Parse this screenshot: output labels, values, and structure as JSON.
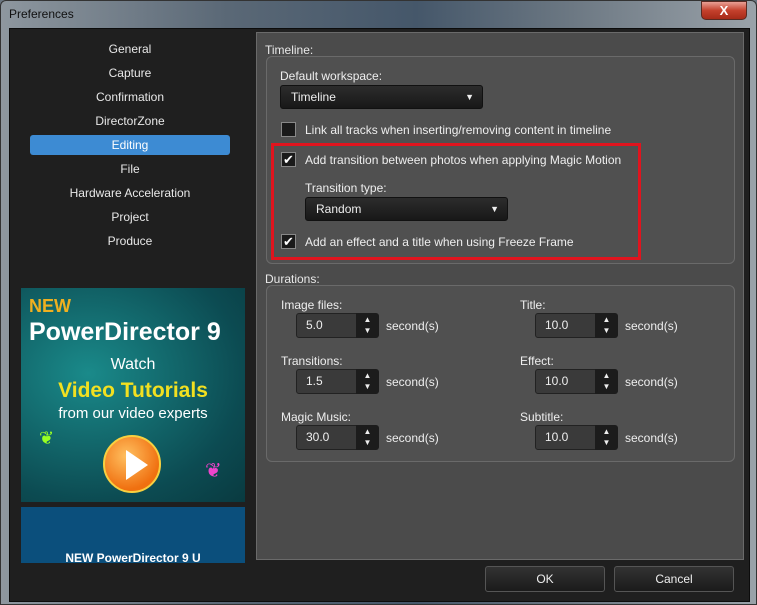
{
  "window": {
    "title": "Preferences",
    "close": "X"
  },
  "nav": [
    "General",
    "Capture",
    "Confirmation",
    "DirectorZone",
    "Editing",
    "File",
    "Hardware Acceleration",
    "Project",
    "Produce"
  ],
  "timeline": {
    "label": "Timeline:",
    "workspace_label": "Default workspace:",
    "workspace_value": "Timeline",
    "link_tracks": "Link all tracks when inserting/removing content in timeline",
    "link_checked": false,
    "add_transition": "Add transition between photos when applying Magic Motion",
    "add_transition_checked": true,
    "transition_type_label": "Transition type:",
    "transition_type_value": "Random",
    "freeze": "Add an effect and a title when using Freeze Frame",
    "freeze_checked": true
  },
  "durations": {
    "label": "Durations:",
    "unit": "second(s)",
    "items": [
      {
        "label": "Image files:",
        "value": "5.0"
      },
      {
        "label": "Transitions:",
        "value": "1.5"
      },
      {
        "label": "Magic Music:",
        "value": "30.0"
      },
      {
        "label": "Title:",
        "value": "10.0"
      },
      {
        "label": "Effect:",
        "value": "10.0"
      },
      {
        "label": "Subtitle:",
        "value": "10.0"
      }
    ]
  },
  "ad": {
    "new": "NEW",
    "product": "PowerDirector 9",
    "watch": "Watch",
    "tutorials": "Video Tutorials",
    "experts": "from our video experts",
    "banner2": "NEW PowerDirector 9 U"
  },
  "buttons": {
    "ok": "OK",
    "cancel": "Cancel"
  }
}
